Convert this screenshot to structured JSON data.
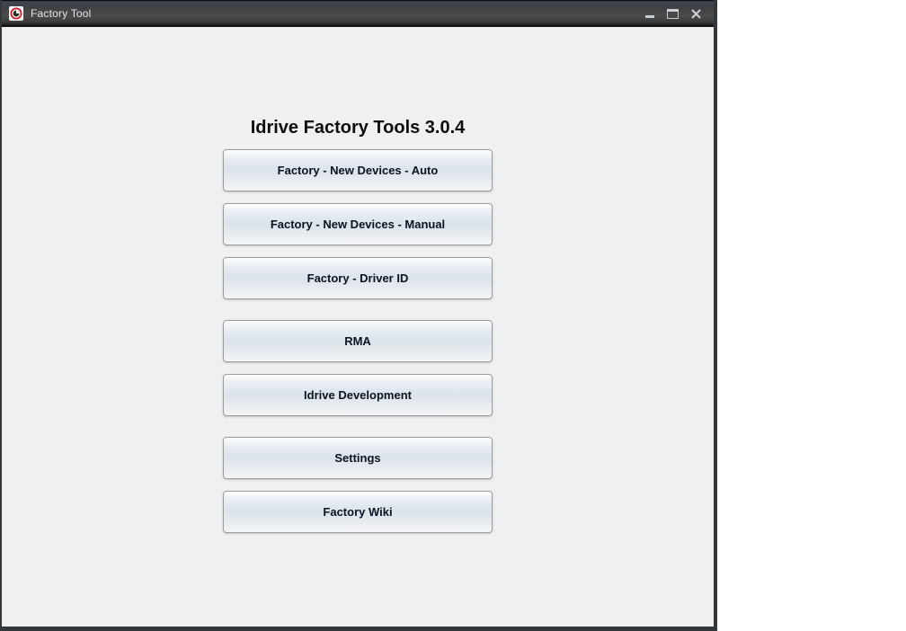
{
  "window": {
    "title": "Factory Tool"
  },
  "main": {
    "heading": "Idrive Factory Tools 3.0.4",
    "button_groups": [
      {
        "buttons": [
          "Factory - New Devices - Auto",
          "Factory - New Devices - Manual",
          "Factory - Driver ID"
        ]
      },
      {
        "buttons": [
          "RMA",
          "Idrive Development"
        ]
      },
      {
        "buttons": [
          "Settings",
          "Factory Wiki"
        ]
      }
    ]
  },
  "icons": {
    "app_icon": "factory-tool-app-icon",
    "titlebar_icons": [
      "minimize-icon",
      "maximize-icon",
      "close-icon"
    ]
  },
  "colors": {
    "titlebar_bg": "#3f444c",
    "titlebar_text": "#e2e5e9",
    "content_bg": "#eef0f2",
    "window_border": "#33363b",
    "button_border": "#9c9c9c",
    "button_gradient_mid": "#dce3ea",
    "button_text": "#0d1320",
    "app_icon_ring": "#cc2127",
    "control_glyph": "#c9ced4"
  }
}
